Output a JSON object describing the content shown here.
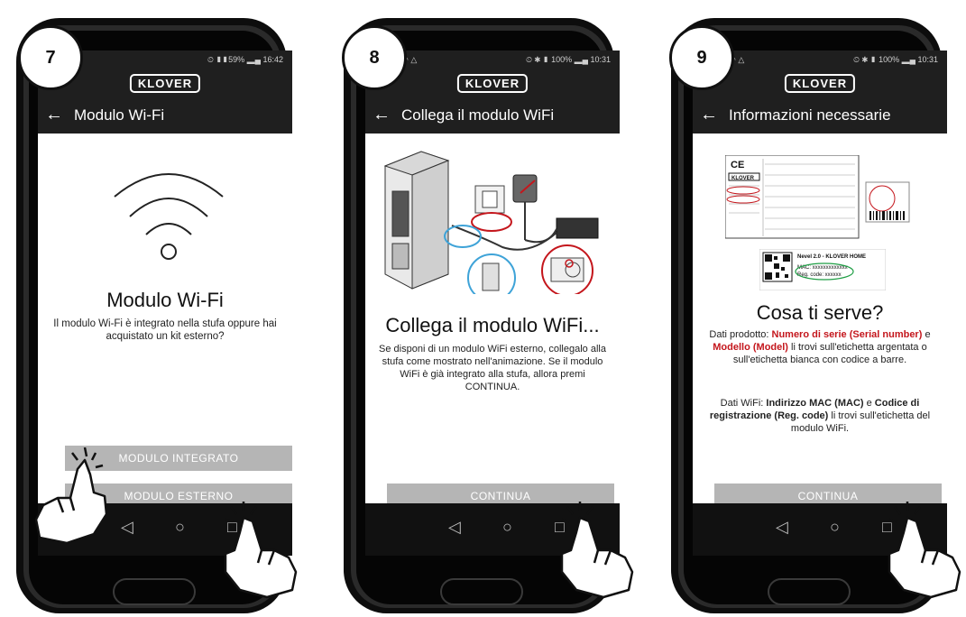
{
  "brand": "KLOVER",
  "screens": [
    {
      "step": "7",
      "status_right": "⏲ ▮▮59% ▂▄ 16:42",
      "status_left": "◠",
      "title": "Modulo Wi-Fi",
      "heading": "Modulo Wi-Fi",
      "description": "Il modulo Wi-Fi è integrato nella stufa oppure hai acquistato un kit esterno?",
      "button_integrated": "MODULO INTEGRATO",
      "button_external": "MODULO ESTERNO"
    },
    {
      "step": "8",
      "status_right": "⏲ ✱ ▮ 100% ▂▄ 10:31",
      "status_left": "◠ △",
      "title": "Collega il modulo WiFi",
      "heading": "Collega il modulo WiFi...",
      "description": "Se disponi di un modulo WiFi esterno, collegalo alla stufa come mostrato nell'animazione. Se il modulo WiFi è già integrato alla stufa, allora premi CONTINUA.",
      "button": "CONTINUA"
    },
    {
      "step": "9",
      "status_right": "⏲ ✱ ▮ 100% ▂▄ 10:31",
      "status_left": "◠ △",
      "title": "Informazioni necessarie",
      "heading": "Cosa ti serve?",
      "desc1_a": "Dati prodotto: ",
      "desc1_b": "Numero di serie (Serial number)",
      "desc1_c": " e ",
      "desc1_d": "Modello (Model)",
      "desc1_e": " li trovi sull'etichetta argentata o sull'etichetta bianca con codice a barre.",
      "desc2_a": "Dati WiFi: ",
      "desc2_b": "Indirizzo MAC (MAC)",
      "desc2_c": " e ",
      "desc2_d": "Codice di registrazione (Reg. code)",
      "desc2_e": " li trovi sull'etichetta del modulo WiFi.",
      "label_ce": "CE",
      "label_brand": "KLOVER",
      "wifi_label_line1": "Nevel 2.0 - KLOVER HOME",
      "wifi_label_line2": "MAC: xxxxxxxxxxxxx",
      "wifi_label_line3": "Reg. code: xxxxxx",
      "button": "CONTINUA"
    }
  ],
  "nav": {
    "back": "◁",
    "home": "○",
    "recent": "□"
  },
  "colors": {
    "appbar": "#1f1f1f",
    "button": "#b5b5b5",
    "accent_red": "#c4161c"
  }
}
